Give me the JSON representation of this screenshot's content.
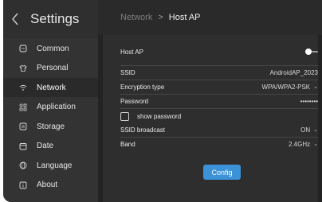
{
  "sidebar": {
    "title": "Settings",
    "items": [
      {
        "label": "Common",
        "icon": "square-icon"
      },
      {
        "label": "Personal",
        "icon": "shirt-icon"
      },
      {
        "label": "Network",
        "icon": "wifi-icon"
      },
      {
        "label": "Application",
        "icon": "apps-icon"
      },
      {
        "label": "Storage",
        "icon": "storage-icon"
      },
      {
        "label": "Date",
        "icon": "calendar-icon"
      },
      {
        "label": "Language",
        "icon": "globe-icon"
      },
      {
        "label": "About",
        "icon": "info-icon"
      }
    ],
    "active_index": 2
  },
  "header": {
    "parent": "Network",
    "separator": ">",
    "current": "Host AP"
  },
  "form": {
    "host_ap_label": "Host AP",
    "host_ap_enabled": true,
    "ssid_label": "SSID",
    "ssid_value": "AndroidAP_2023",
    "encryption_label": "Encryption type",
    "encryption_value": "WPA/WPA2-PSK",
    "password_label": "Password",
    "password_value": "••••••••",
    "show_password_label": "show password",
    "show_password_checked": false,
    "broadcast_label": "SSID broadcast",
    "broadcast_value": "ON",
    "band_label": "Band",
    "band_value": "2.4GHz",
    "config_label": "Config"
  },
  "colors": {
    "accent": "#3b92d8",
    "background": "#232323",
    "sidebar": "#333333"
  }
}
